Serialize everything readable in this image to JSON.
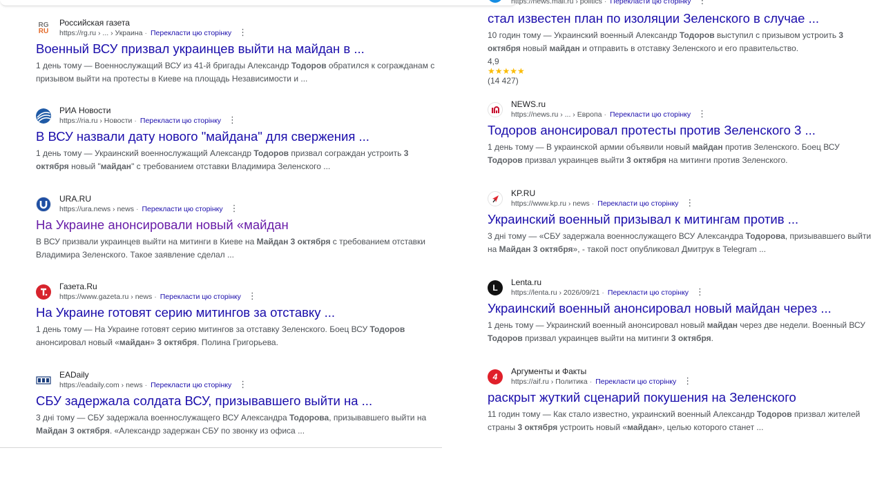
{
  "left": [
    {
      "site": "Российская газета",
      "url": "https://rg.ru › ... › Украина",
      "translate": "Перекласти цю сторінку",
      "title": "Военный ВСУ призвал украинцев выйти на майдан в ...",
      "visited": false,
      "snippet": [
        {
          "t": "1 день тому — Военнослужащий ВСУ из 41-й бригады Александр "
        },
        {
          "b": "Тодоров"
        },
        {
          "t": " обратился к согражданам с призывом выйти на протесты в Киеве на площадь Независимости и ..."
        }
      ],
      "favicon": "rg-icon"
    },
    {
      "site": "РИА Новости",
      "url": "https://ria.ru › Новости",
      "translate": "Перекласти цю сторінку",
      "title": "В ВСУ назвали дату нового \"майдана\" для свержения ...",
      "visited": false,
      "snippet": [
        {
          "t": "1 день тому — Украинский военнослужащий Александр "
        },
        {
          "b": "Тодоров"
        },
        {
          "t": " призвал сограждан устроить "
        },
        {
          "b": "3 октября"
        },
        {
          "t": " новый \""
        },
        {
          "b": "майдан"
        },
        {
          "t": "\" с требованием отставки Владимира Зеленского ..."
        }
      ],
      "favicon": "ria-icon"
    },
    {
      "site": "URA.RU",
      "url": "https://ura.news › news",
      "translate": "Перекласти цю сторінку",
      "title": "На Украине анонсировали новый «майдан",
      "visited": true,
      "snippet": [
        {
          "t": "В ВСУ призвали украинцев выйти на митинги в Киеве на "
        },
        {
          "b": "Майдан 3 октября"
        },
        {
          "t": " с требованием отставки Владимира Зеленского. Такое заявление сделал ..."
        }
      ],
      "favicon": "ura-icon"
    },
    {
      "site": "Газета.Ru",
      "url": "https://www.gazeta.ru › news",
      "translate": "Перекласти цю сторінку",
      "title": "На Украине готовят серию митингов за отставку ...",
      "visited": false,
      "snippet": [
        {
          "t": "1 день тому — На Украине готовят серию митингов за отставку Зеленского. Боец ВСУ "
        },
        {
          "b": "Тодоров"
        },
        {
          "t": " анонсировал новый «"
        },
        {
          "b": "майдан"
        },
        {
          "t": "» "
        },
        {
          "b": "3 октября"
        },
        {
          "t": ". Полина Григорьева."
        }
      ],
      "favicon": "gazeta-icon"
    },
    {
      "site": "EADaily",
      "url": "https://eadaily.com › news",
      "translate": "Перекласти цю сторінку",
      "title": "СБУ задержала солдата ВСУ, призывавшего выйти на ...",
      "visited": false,
      "snippet": [
        {
          "t": "3 дні тому — СБУ задержала военнослужащего ВСУ Александра "
        },
        {
          "b": "Тодорова"
        },
        {
          "t": ", призывавшего выйти на "
        },
        {
          "b": "Майдан 3 октября"
        },
        {
          "t": ". «Александр задержан СБУ по звонку из офиса ..."
        }
      ],
      "favicon": "eadaily-icon"
    }
  ],
  "right": [
    {
      "site": "",
      "url": "https://news.mail.ru › politics",
      "translate": "Перекласти цю сторінку",
      "title": "стал известен план по изоляции Зеленского в случае ...",
      "visited": false,
      "snippet": [
        {
          "t": "10 годин тому — Украинский военный Александр "
        },
        {
          "b": "Тодоров"
        },
        {
          "t": " выступил с призывом устроить "
        },
        {
          "b": "3 октября"
        },
        {
          "t": " новый "
        },
        {
          "b": "майдан"
        },
        {
          "t": " и отправить в отставку Зеленского и его правительство."
        }
      ],
      "rating": {
        "value": "4,9",
        "stars": "★★★★★",
        "count": "(14 427)"
      },
      "favicon": "mail-icon"
    },
    {
      "site": "NEWS.ru",
      "url": "https://news.ru › ... › Европа",
      "translate": "Перекласти цю сторінку",
      "title": "Тодоров анонсировал протесты против Зеленского 3 ...",
      "visited": false,
      "snippet": [
        {
          "t": "1 день тому — В украинской армии объявили новый "
        },
        {
          "b": "майдан"
        },
        {
          "t": " против Зеленского. Боец ВСУ "
        },
        {
          "b": "Тодоров"
        },
        {
          "t": " призвал украинцев выйти "
        },
        {
          "b": "3 октября"
        },
        {
          "t": " на митинги против Зеленского."
        }
      ],
      "favicon": "newsru-icon"
    },
    {
      "site": "KP.RU",
      "url": "https://www.kp.ru › news",
      "translate": "Перекласти цю сторінку",
      "title": "Украинский военный призывал к митингам против ...",
      "visited": false,
      "snippet": [
        {
          "t": "3 дні тому — «СБУ задержала военнослужащего ВСУ Александра "
        },
        {
          "b": "Тодорова"
        },
        {
          "t": ", призывавшего выйти на "
        },
        {
          "b": "Майдан 3 октября"
        },
        {
          "t": "», - такой пост опубликовал Дмитрук в Telegram ..."
        }
      ],
      "favicon": "kp-icon"
    },
    {
      "site": "Lenta.ru",
      "url": "https://lenta.ru › 2026/09/21",
      "translate": "Перекласти цю сторінку",
      "title": "Украинский военный анонсировал новый майдан через ...",
      "visited": false,
      "snippet": [
        {
          "t": "1 день тому — Украинский военный анонсировал новый "
        },
        {
          "b": "майдан"
        },
        {
          "t": " через две недели. Военный ВСУ "
        },
        {
          "b": "Тодоров"
        },
        {
          "t": " призвал украинцев выйти на митинги "
        },
        {
          "b": "3 октября"
        },
        {
          "t": "."
        }
      ],
      "favicon": "lenta-icon"
    },
    {
      "site": "Аргументы и Факты",
      "url": "https://aif.ru › Политика",
      "translate": "Перекласти цю сторінку",
      "title": "раскрыт жуткий сценарий покушения на Зеленского",
      "visited": false,
      "snippet": [
        {
          "t": "11 годин тому — Как стало известно, украинский военный Александр "
        },
        {
          "b": "Тодоров"
        },
        {
          "t": " призвал жителей страны "
        },
        {
          "b": "3 октября"
        },
        {
          "t": " устроить новый «"
        },
        {
          "b": "майдан"
        },
        {
          "t": "», целью которого станет ..."
        }
      ],
      "favicon": "aif-icon"
    }
  ],
  "favicon_text": {
    "rg": "RG",
    "rg2": "RU",
    "aif": "4"
  },
  "colors": {
    "link": "#1a0dab",
    "visited": "#681da8",
    "snippet": "#4d5156",
    "star": "#fbbc04"
  }
}
